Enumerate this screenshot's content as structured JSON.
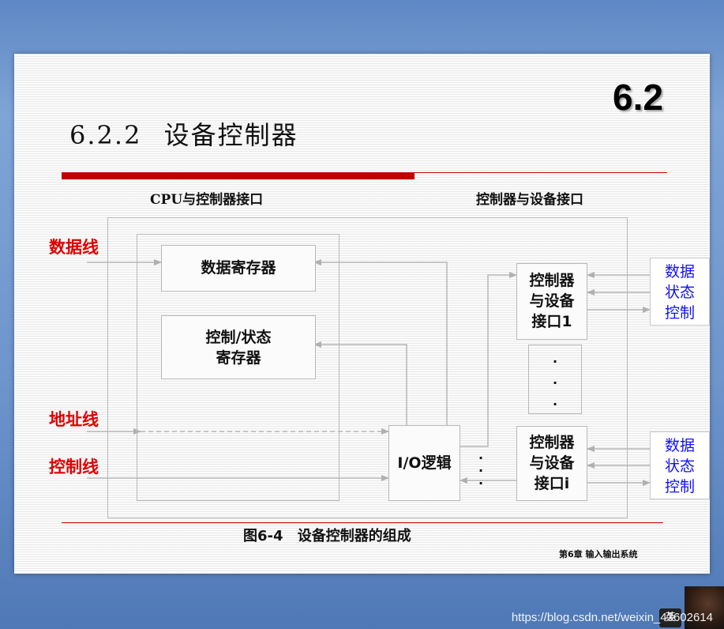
{
  "slide": {
    "section_badge": "6.2",
    "title": "6.2.2 设备控制器",
    "header_left": "CPU与控制器接口",
    "header_right": "控制器与设备接口",
    "footer": "第6章 输入输出系统"
  },
  "diagram": {
    "left_labels": [
      "数据线",
      "地址线",
      "控制线"
    ],
    "data_register": "数据寄存器",
    "control_status_register": [
      "控制/状态",
      "寄存器"
    ],
    "io_logic": "I/O逻辑",
    "interface_1": [
      "控制器",
      "与设备",
      "接口1"
    ],
    "interface_i": [
      "控制器",
      "与设备",
      "接口i"
    ],
    "device_signals_1": [
      "数据",
      "状态",
      "控制"
    ],
    "device_signals_i": [
      "数据",
      "状态",
      "控制"
    ],
    "caption": "图6-4 设备控制器的组成"
  },
  "overlay": {
    "watermark": "https://blog.csdn.net/weixin_43602614",
    "ime_indicator": "英"
  },
  "colors": {
    "accent_red": "#c00000",
    "label_red": "#e00000",
    "signal_blue": "#1010ff"
  }
}
